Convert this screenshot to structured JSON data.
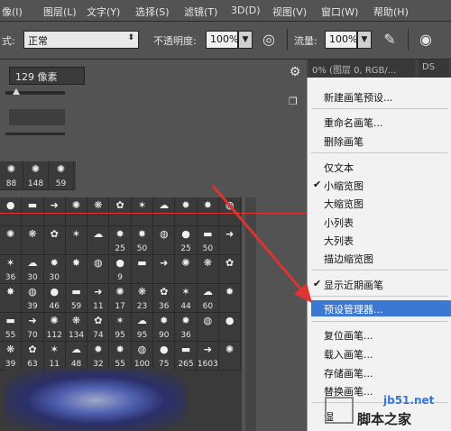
{
  "menubar": [
    "像(I)",
    "图层(L)",
    "文字(Y)",
    "选择(S)",
    "滤镜(T)",
    "3D(D)",
    "视图(V)",
    "窗口(W)",
    "帮助(H)"
  ],
  "options": {
    "mode_label": "式:",
    "mode_value": "正常",
    "opacity_label": "不透明度:",
    "opacity_value": "100%",
    "flow_label": "流量:",
    "flow_value": "100%"
  },
  "doc_tabs": [
    "0% (图层 0, RGB/...",
    "DS"
  ],
  "brush_panel": {
    "size_value": "129 像素",
    "recent_brushes": [
      "88",
      "148",
      "59"
    ],
    "grid_rows": [
      [
        "",
        "",
        "",
        "",
        "",
        "",
        "",
        "",
        "",
        "",
        ""
      ],
      [
        "",
        "",
        "",
        "",
        "",
        "25",
        "50",
        "",
        "25",
        "50",
        ""
      ],
      [
        "36",
        "30",
        "30",
        "",
        "",
        "9",
        "",
        "",
        "",
        "",
        ""
      ],
      [
        "",
        "39",
        "46",
        "59",
        "11",
        "17",
        "23",
        "36",
        "44",
        "60",
        ""
      ],
      [
        "55",
        "70",
        "112",
        "134",
        "74",
        "95",
        "95",
        "90",
        "36",
        "",
        ""
      ],
      [
        "39",
        "63",
        "11",
        "48",
        "32",
        "55",
        "100",
        "75",
        "265",
        "1603",
        ""
      ]
    ]
  },
  "context_menu": {
    "items": [
      "新建画笔预设...",
      "重命名画笔...",
      "删除画笔",
      "仅文本",
      "小缩览图",
      "大缩览图",
      "小列表",
      "大列表",
      "描边缩览图",
      "显示近期画笔",
      "预设管理器...",
      "复位画笔...",
      "载入画笔...",
      "存储画笔...",
      "替换画笔...",
      "湿"
    ],
    "checked": [
      "小缩览图",
      "显示近期画笔"
    ],
    "highlighted": "预设管理器..."
  },
  "watermark": {
    "site": "jb51.net",
    "name": "脚本之家"
  },
  "colors": {
    "accent": "#3a78d4",
    "annotation": "#dd3333"
  }
}
